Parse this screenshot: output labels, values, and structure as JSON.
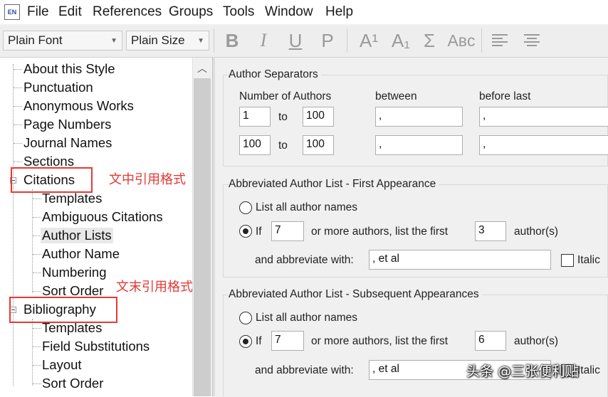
{
  "app": {
    "icon_text": "EN"
  },
  "menu": [
    "File",
    "Edit",
    "References",
    "Groups",
    "Tools",
    "Window",
    "Help"
  ],
  "toolbar": {
    "font_value": "Plain Font",
    "size_value": "Plain Size",
    "format_buttons": [
      "B",
      "I",
      "U",
      "P",
      "A¹",
      "A₁",
      "Σ",
      "Aʙᴄ"
    ]
  },
  "tree": {
    "items": [
      "About this Style",
      "Punctuation",
      "Anonymous Works",
      "Page Numbers",
      "Journal Names",
      "Sections",
      "Citations",
      "Templates",
      "Ambiguous Citations",
      "Author Lists",
      "Author Name",
      "Numbering",
      "Sort Order",
      "Bibliography",
      "Templates",
      "Field Substitutions",
      "Layout",
      "Sort Order"
    ],
    "annotations": [
      "文中引用格式",
      "文末引用格式"
    ]
  },
  "author_separators": {
    "title": "Author Separators",
    "col_number": "Number of Authors",
    "col_between": "between",
    "col_before_last": "before last",
    "to_label": "to",
    "rows": [
      {
        "from": "1",
        "to": "100",
        "between": ",",
        "before_last": ","
      },
      {
        "from": "100",
        "to": "100",
        "between": ",",
        "before_last": ","
      }
    ]
  },
  "first_appearance": {
    "title": "Abbreviated Author List - First Appearance",
    "list_all_label": "List all author names",
    "if_label": "If",
    "if_value": "7",
    "more_label": "or more authors, list the first",
    "first_value": "3",
    "authors_label": "author(s)",
    "abbrev_label": "and abbreviate with:",
    "abbrev_value": ", et al",
    "italic_label": "Italic",
    "selected": "if"
  },
  "subsequent": {
    "title": "Abbreviated Author List - Subsequent Appearances",
    "list_all_label": "List all author names",
    "if_label": "If",
    "if_value": "7",
    "more_label": "or more authors, list the first",
    "first_value": "6",
    "authors_label": "author(s)",
    "abbrev_label": "and abbreviate with:",
    "abbrev_value": ", et al",
    "italic_label": "Italic",
    "selected": "if"
  },
  "watermark": "头条 @三张便利贴"
}
